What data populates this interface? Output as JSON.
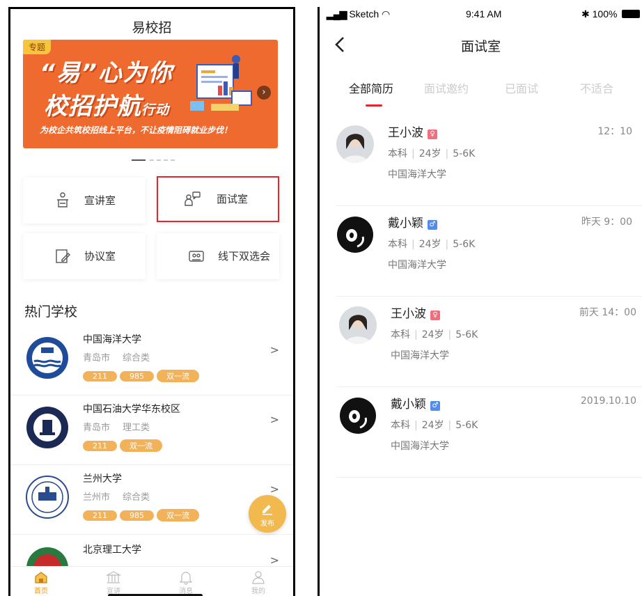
{
  "left_app": {
    "title": "易校招",
    "banner": {
      "tag": "专题",
      "line1": "“易”心为你",
      "line2_main": "校招护航",
      "line2_small": "行动",
      "line3": "为校企共筑校招线上平台，不让疫情阻碍就业步伐！"
    },
    "menu": [
      {
        "label": "宣讲室",
        "icon": "podium-icon",
        "highlighted": false
      },
      {
        "label": "面试室",
        "icon": "interview-icon",
        "highlighted": true
      },
      {
        "label": "协议室",
        "icon": "agreement-icon",
        "highlighted": false
      },
      {
        "label": "线下双选会",
        "icon": "job-fair-icon",
        "highlighted": false
      }
    ],
    "section_title": "热门学校",
    "schools": [
      {
        "name": "中国海洋大学",
        "city": "青岛市",
        "type": "综合类",
        "tags": [
          "211",
          "985",
          "双一流"
        ]
      },
      {
        "name": "中国石油大学华东校区",
        "city": "青岛市",
        "type": "理工类",
        "tags": [
          "211",
          "双一流"
        ]
      },
      {
        "name": "兰州大学",
        "city": "兰州市",
        "type": "综合类",
        "tags": [
          "211",
          "985",
          "双一流"
        ]
      },
      {
        "name": "北京理工大学",
        "city": "",
        "type": "",
        "tags": []
      }
    ],
    "fab_label": "发布",
    "tabbar": [
      {
        "label": "首页",
        "icon": "home-icon",
        "active": true
      },
      {
        "label": "宣讲",
        "icon": "building-icon",
        "active": false
      },
      {
        "label": "消息",
        "icon": "bell-icon",
        "active": false
      },
      {
        "label": "我的",
        "icon": "user-icon",
        "active": false
      }
    ],
    "colors": {
      "accent": "#e89a1c",
      "banner": "#ef6a2e",
      "highlight_border": "#e0272d",
      "tag": "#f2b25a"
    }
  },
  "right_app": {
    "status": {
      "carrier": "Sketch",
      "time": "9:41 AM",
      "battery": "100%"
    },
    "nav_title": "面试室",
    "filter_tabs": [
      {
        "label": "全部简历",
        "active": true
      },
      {
        "label": "面试邀约",
        "active": false
      },
      {
        "label": "已面试",
        "active": false
      },
      {
        "label": "不适合",
        "active": false
      }
    ],
    "candidates": [
      {
        "name": "王小波",
        "gender": "female",
        "gender_symbol": "♀",
        "degree": "本科",
        "age": "24岁",
        "salary": "5-6K",
        "school": "中国海洋大学",
        "time": "12：10",
        "avatar": "photo"
      },
      {
        "name": "戴小颖",
        "gender": "male",
        "gender_symbol": "♂",
        "degree": "本科",
        "age": "24岁",
        "salary": "5-6K",
        "school": "中国海洋大学",
        "time": "昨天 9：00",
        "avatar": "cat"
      },
      {
        "name": "王小波",
        "gender": "female",
        "gender_symbol": "♀",
        "degree": "本科",
        "age": "24岁",
        "salary": "5-6K",
        "school": "中国海洋大学",
        "time": "前天 14：00",
        "avatar": "photo"
      },
      {
        "name": "戴小颖",
        "gender": "male",
        "gender_symbol": "♂",
        "degree": "本科",
        "age": "24岁",
        "salary": "5-6K",
        "school": "中国海洋大学",
        "time": "2019.10.10",
        "avatar": "cat"
      }
    ],
    "colors": {
      "tab_indicator": "#e0272d",
      "female": "#f06e7e",
      "male": "#4f8ef0"
    }
  }
}
